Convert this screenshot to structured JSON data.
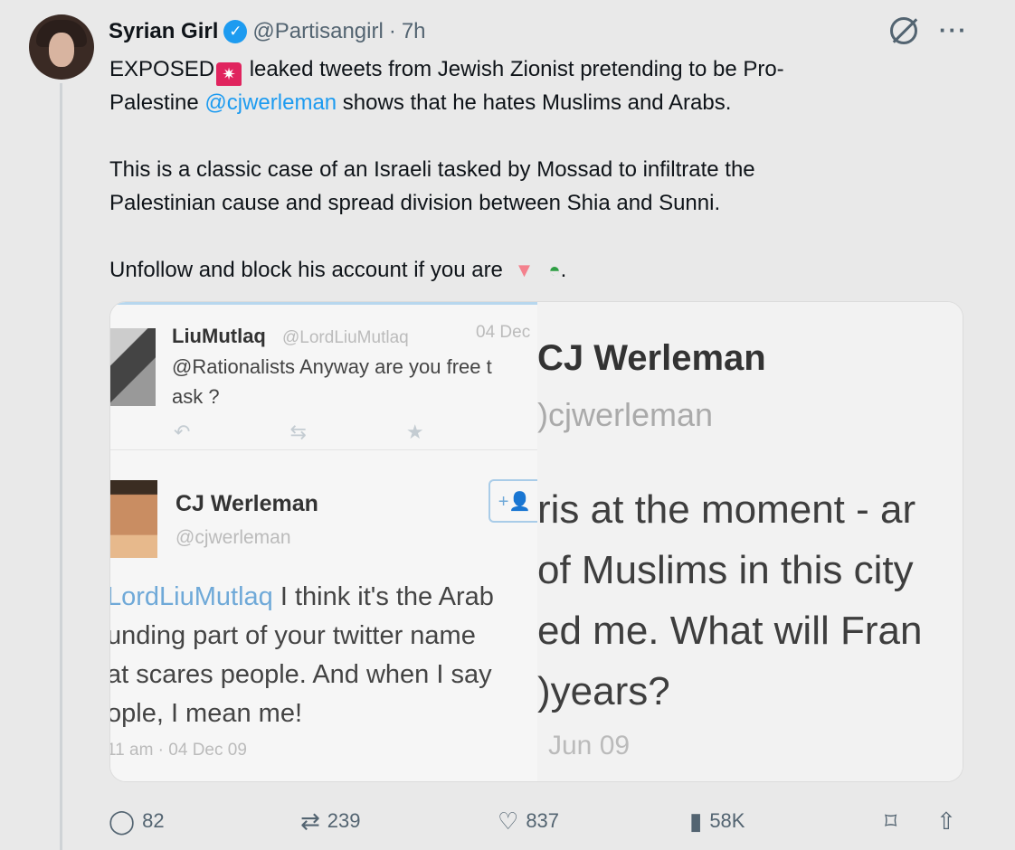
{
  "author": {
    "name": "Syrian Girl",
    "handle": "@Partisangirl",
    "separator": "·",
    "time": "7h"
  },
  "tweet": {
    "line1_before_emoji": "EXPOSED",
    "line1_after_emoji": " leaked tweets from Jewish Zionist pretending to be Pro-",
    "line2_before_mention": "Palestine ",
    "mention": "@cjwerleman",
    "line2_after_mention": " shows that he hates Muslims and Arabs.",
    "para2_line1": "This is a classic case of an Israeli tasked by Mossad to infiltrate the",
    "para2_line2": "Palestinian cause and spread division between Shia and Sunni.",
    "para3_before": "Unfollow and block his account if you are ",
    "para3_end": "."
  },
  "media": {
    "left": {
      "user1_name": "LiuMutlaq",
      "user1_handle": "@LordLiuMutlaq",
      "user1_date": "04 Dec",
      "user1_text_line1": "@Rationalists Anyway are you free t",
      "user1_text_line2": "ask ?",
      "user2_name": "CJ Werleman",
      "user2_handle": "@cjwerleman",
      "reply_mention": "LordLiuMutlaq",
      "reply_line1_rest": " I think it's the Arab",
      "reply_line2": "unding part of your twitter name",
      "reply_line3": "at scares people. And when I say",
      "reply_line4": "ople, I mean me!",
      "reply_time": "11 am · 04 Dec 09"
    },
    "right": {
      "name": "CJ Werleman",
      "handle": ")cjwerleman",
      "line1": "ris at the moment - ar",
      "line2": "of Muslims in this city",
      "line3": "ed me. What will Fran",
      "line4": ")years?",
      "date": "Jun 09"
    }
  },
  "stats": {
    "replies": "82",
    "retweets": "239",
    "likes": "837",
    "views": "58K"
  }
}
